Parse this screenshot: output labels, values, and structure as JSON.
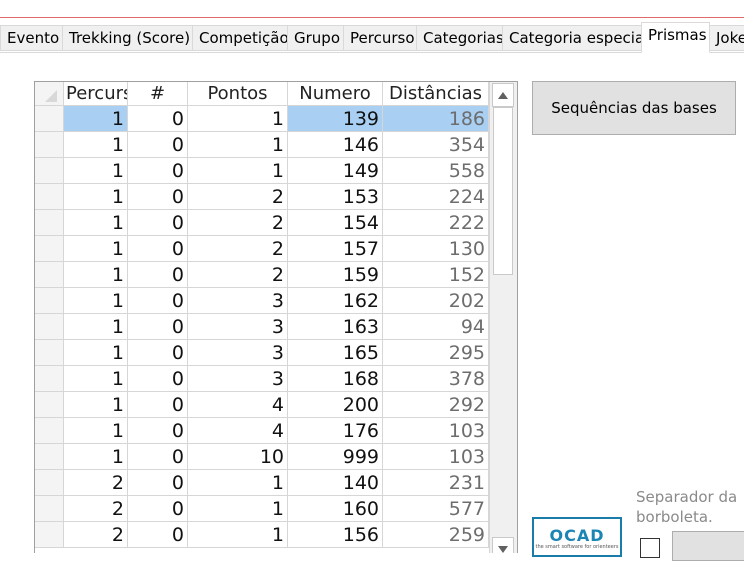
{
  "tabs": [
    {
      "label": "Evento"
    },
    {
      "label": "Trekking (Score)"
    },
    {
      "label": "Competição"
    },
    {
      "label": "Grupo"
    },
    {
      "label": "Percurso"
    },
    {
      "label": "Categorias"
    },
    {
      "label": "Categoria especial"
    },
    {
      "label": "Prismas"
    },
    {
      "label": "Joke"
    }
  ],
  "active_tab": "Prismas",
  "grid": {
    "columns": [
      "Percurs",
      "#",
      "Pontos",
      "Numero",
      "Distâncias"
    ],
    "rows": [
      [
        "1",
        "0",
        "1",
        "139",
        "186"
      ],
      [
        "1",
        "0",
        "1",
        "146",
        "354"
      ],
      [
        "1",
        "0",
        "1",
        "149",
        "558"
      ],
      [
        "1",
        "0",
        "2",
        "153",
        "224"
      ],
      [
        "1",
        "0",
        "2",
        "154",
        "222"
      ],
      [
        "1",
        "0",
        "2",
        "157",
        "130"
      ],
      [
        "1",
        "0",
        "2",
        "159",
        "152"
      ],
      [
        "1",
        "0",
        "3",
        "162",
        "202"
      ],
      [
        "1",
        "0",
        "3",
        "163",
        "94"
      ],
      [
        "1",
        "0",
        "3",
        "165",
        "295"
      ],
      [
        "1",
        "0",
        "3",
        "168",
        "378"
      ],
      [
        "1",
        "0",
        "4",
        "200",
        "292"
      ],
      [
        "1",
        "0",
        "4",
        "176",
        "103"
      ],
      [
        "1",
        "0",
        "10",
        "999",
        "103"
      ],
      [
        "2",
        "0",
        "1",
        "140",
        "231"
      ],
      [
        "2",
        "0",
        "1",
        "160",
        "577"
      ],
      [
        "2",
        "0",
        "1",
        "156",
        "259"
      ]
    ],
    "selected_row": 0
  },
  "buttons": {
    "sequences_label": "Sequências das bases"
  },
  "separator_label": "Separador da borboleta.",
  "logo": {
    "text": "OCAD",
    "subtext": "the smart software for orienteers"
  },
  "colors": {
    "selection": "#a9cff2",
    "top_accent": "#e06a6a",
    "logo": "#1b86b4"
  }
}
